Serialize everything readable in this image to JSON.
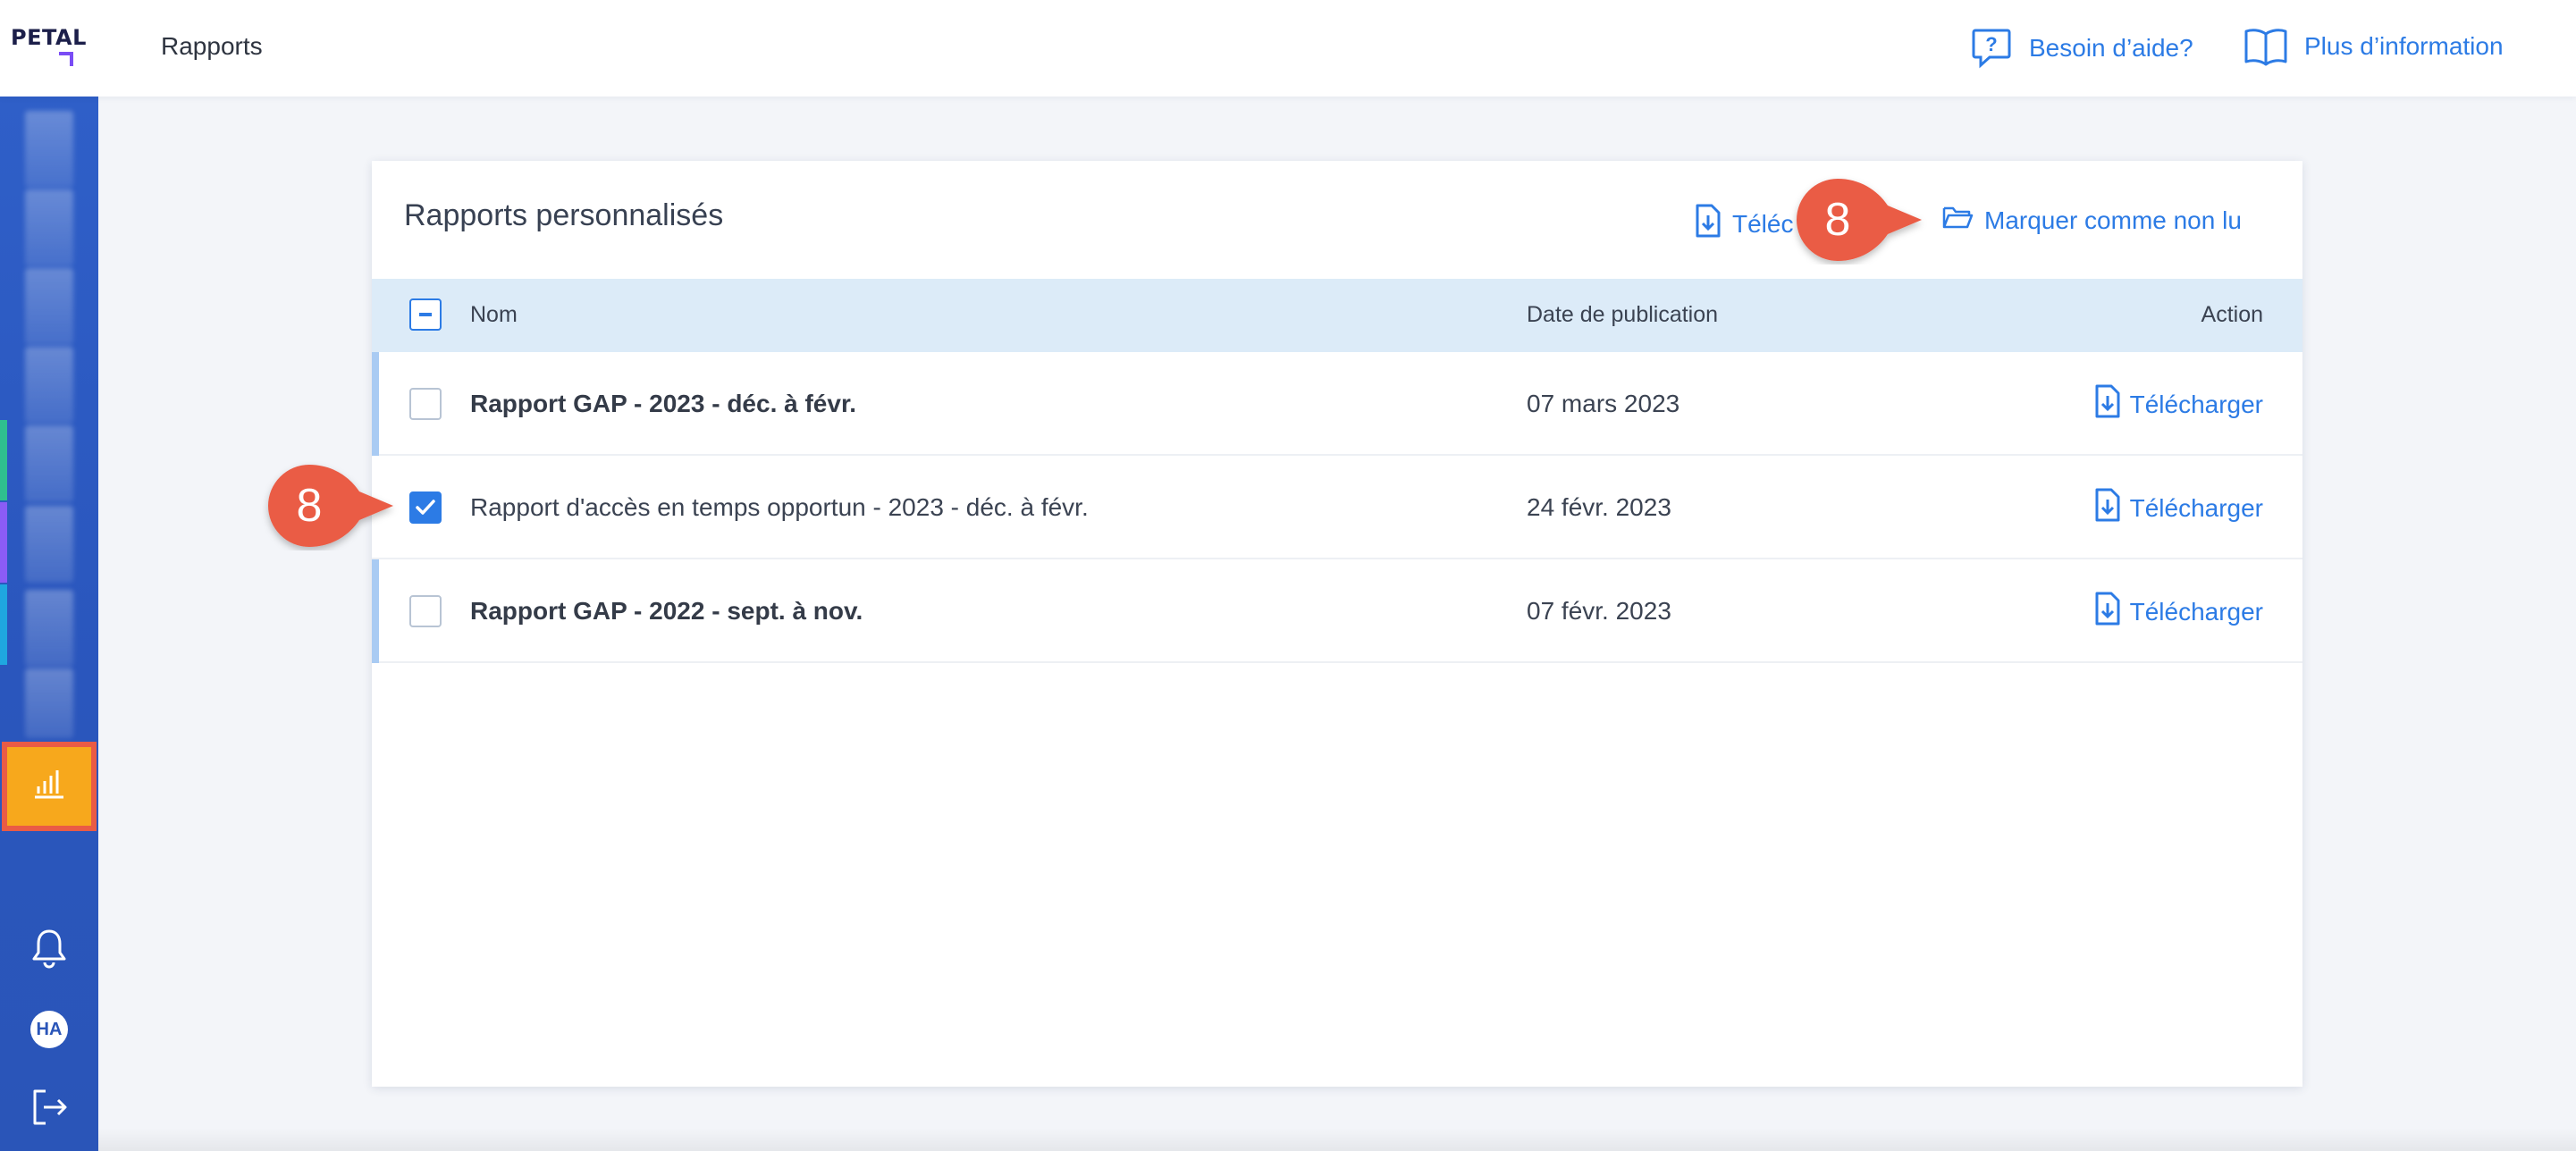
{
  "header": {
    "logo_text": "PETAL",
    "page_title": "Rapports",
    "help_label": "Besoin d’aide?",
    "info_label": "Plus d’information"
  },
  "sidebar": {
    "avatar_initials": "HA",
    "accent_colors": [
      "#2fbf8f",
      "#8b5cf6",
      "#1fa7e0"
    ],
    "active_item_icon": "bar-chart-icon",
    "bottom_icons": [
      "bell-icon",
      "avatar",
      "logout-icon"
    ]
  },
  "card": {
    "title": "Rapports personnalisés",
    "download_all_label": "Téléc",
    "mark_unread_label": "Marquer comme non lu",
    "columns": {
      "name": "Nom",
      "date": "Date de publication",
      "action": "Action"
    },
    "rows": [
      {
        "name": "Rapport GAP - 2023 - déc. à févr.",
        "date": "07 mars 2023",
        "action": "Télécharger",
        "checked": false,
        "unread": true
      },
      {
        "name": "Rapport d'accès en temps opportun - 2023 - déc. à févr.",
        "date": "24 févr. 2023",
        "action": "Télécharger",
        "checked": true,
        "unread": false
      },
      {
        "name": "Rapport GAP - 2022 - sept. à nov.",
        "date": "07 févr. 2023",
        "action": "Télécharger",
        "checked": false,
        "unread": true
      }
    ]
  },
  "callouts": {
    "toolbar_step": "8",
    "row_step": "8",
    "color": "#ea5b45"
  },
  "colors": {
    "accent": "#2c7be5",
    "sidebar": "#2a55b8",
    "active_item": "#f7a81c",
    "header_row": "#dcebf8"
  }
}
